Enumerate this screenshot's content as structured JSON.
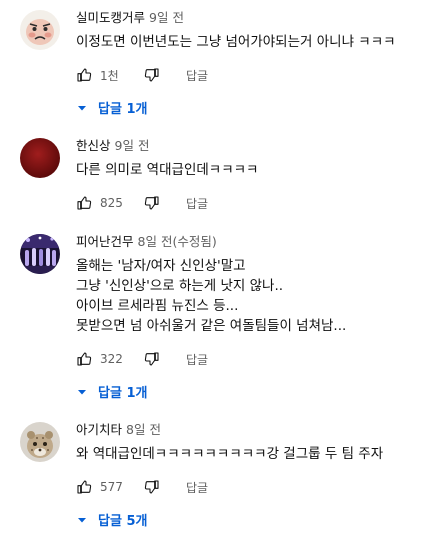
{
  "comments": [
    {
      "author": "실미도캥거루",
      "time": "9일 전",
      "text_lines": [
        "이정도면 이번년도는 그냥 넘어가야되는거 아니냐 ㅋㅋㅋ"
      ],
      "likes": "1천",
      "reply_label": "답글",
      "replies_label": "답글 1개",
      "avatar_icon": "cartoon-face-avatar"
    },
    {
      "author": "한신상",
      "time": "9일 전",
      "text_lines": [
        "다른 의미로 역대급인데ㅋㅋㅋㅋ"
      ],
      "likes": "825",
      "reply_label": "답글",
      "replies_label": "",
      "avatar_icon": "dark-red-circle-avatar"
    },
    {
      "author": "피어난건무",
      "time": "8일 전(수정됨)",
      "text_lines": [
        "올해는 '남자/여자 신인상'말고",
        "그냥 '신인상'으로 하는게 낫지 않나..",
        "아이브 르세라핌 뉴진스 등...",
        "못받으면 넘 아쉬울거 같은 여돌팀들이 넘쳐남..."
      ],
      "likes": "322",
      "reply_label": "답글",
      "replies_label": "답글 1개",
      "avatar_icon": "stage-photo-avatar"
    },
    {
      "author": "아기치타",
      "time": "8일 전",
      "text_lines": [
        "와 역대급인데ㅋㅋㅋㅋㅋㅋㅋㅋㅋ강 걸그룹 두 팀 주자"
      ],
      "likes": "577",
      "reply_label": "답글",
      "replies_label": "답글 5개",
      "avatar_icon": "cheetah-cub-avatar"
    }
  ],
  "colors": {
    "link_blue": "#065fd4",
    "meta_gray": "#606060",
    "text": "#0f0f0f"
  }
}
